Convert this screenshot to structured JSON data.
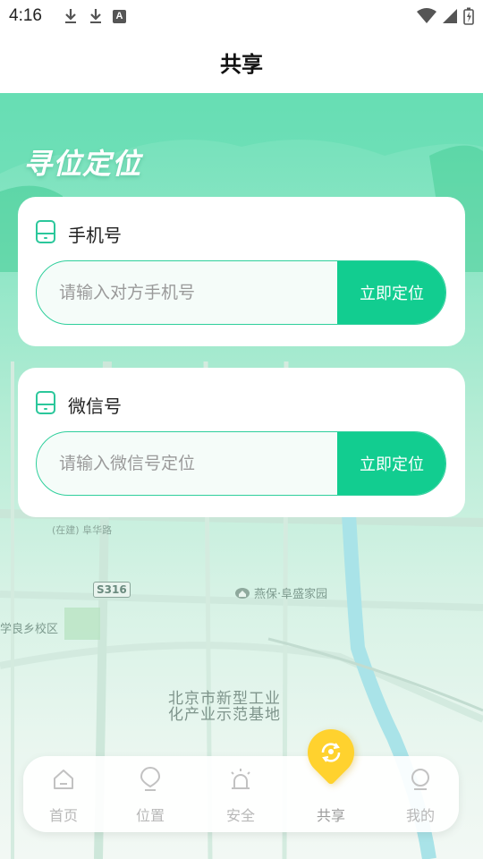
{
  "status_bar": {
    "time": "4:16",
    "icons": [
      "download-icon",
      "download-icon",
      "a-icon",
      "wifi-icon",
      "signal-icon",
      "battery-icon"
    ]
  },
  "header": {
    "title": "共享"
  },
  "banner": {
    "title": "寻位定位"
  },
  "phone_card": {
    "label": "手机号",
    "placeholder": "请输入对方手机号",
    "button": "立即定位"
  },
  "wechat_card": {
    "label": "微信号",
    "placeholder": "请输入微信号定位",
    "button": "立即定位"
  },
  "map_labels": {
    "road1": "(在建) 阜华路",
    "road_code": "S316",
    "poi1": "燕保·阜盛家园",
    "school": "学良乡校区",
    "park_line1": "北京市新型工业",
    "park_line2": "化产业示范基地"
  },
  "tab_bar": {
    "items": [
      {
        "label": "首页",
        "icon": "home-icon"
      },
      {
        "label": "位置",
        "icon": "location-pin-icon"
      },
      {
        "label": "安全",
        "icon": "alarm-icon"
      },
      {
        "label": "共享",
        "icon": "share-location-icon"
      },
      {
        "label": "我的",
        "icon": "user-icon"
      }
    ],
    "active_index": 3
  },
  "colors": {
    "accent": "#12cd90",
    "banner_gradient_top": "#6ee0b8",
    "share_bubble": "#ffd22e"
  }
}
